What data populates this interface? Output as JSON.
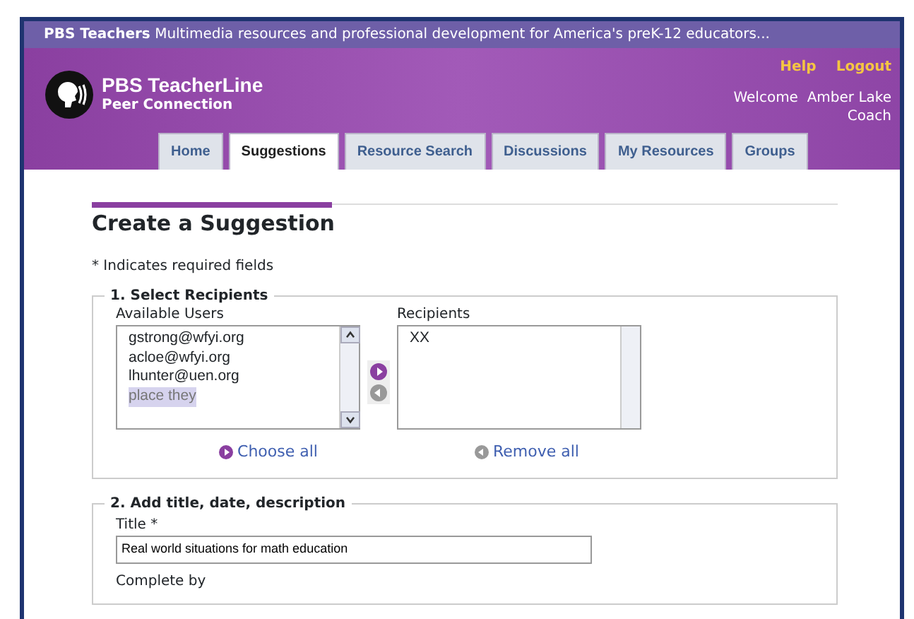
{
  "top_bar": {
    "brand": "PBS Teachers",
    "tagline": "Multimedia resources and professional development for America's preK-12 educators..."
  },
  "header": {
    "logo_title": "PBS TeacherLine",
    "logo_subtitle": "Peer Connection",
    "links": [
      "Help",
      "Logout"
    ],
    "welcome": "Welcome",
    "user_name": "Amber Lake",
    "user_role": "Coach"
  },
  "tabs": [
    {
      "label": "Home",
      "selected": false
    },
    {
      "label": "Suggestions",
      "selected": true
    },
    {
      "label": "Resource Search",
      "selected": false
    },
    {
      "label": "Discussions",
      "selected": false
    },
    {
      "label": "My Resources",
      "selected": false
    },
    {
      "label": "Groups",
      "selected": false
    }
  ],
  "page_title": "Create a Suggestion",
  "required_note": "* Indicates required fields",
  "section_1": {
    "legend": "1. Select Recipients",
    "available_label": "Available Users",
    "available_users": [
      {
        "label": "gstrong@wfyi.org",
        "selected": false
      },
      {
        "label": "acloe@wfyi.org",
        "selected": false
      },
      {
        "label": "lhunter@uen.org",
        "selected": false
      },
      {
        "label": "place they",
        "selected": true
      }
    ],
    "recipients_label": "Recipients",
    "recipients": [
      "XX"
    ],
    "choose_all": "Choose all",
    "remove_all": "Remove all"
  },
  "section_2": {
    "legend": "2. Add title, date, description",
    "title_label": "Title *",
    "title_value": "Real world situations for math education",
    "complete_by_label": "Complete by"
  }
}
